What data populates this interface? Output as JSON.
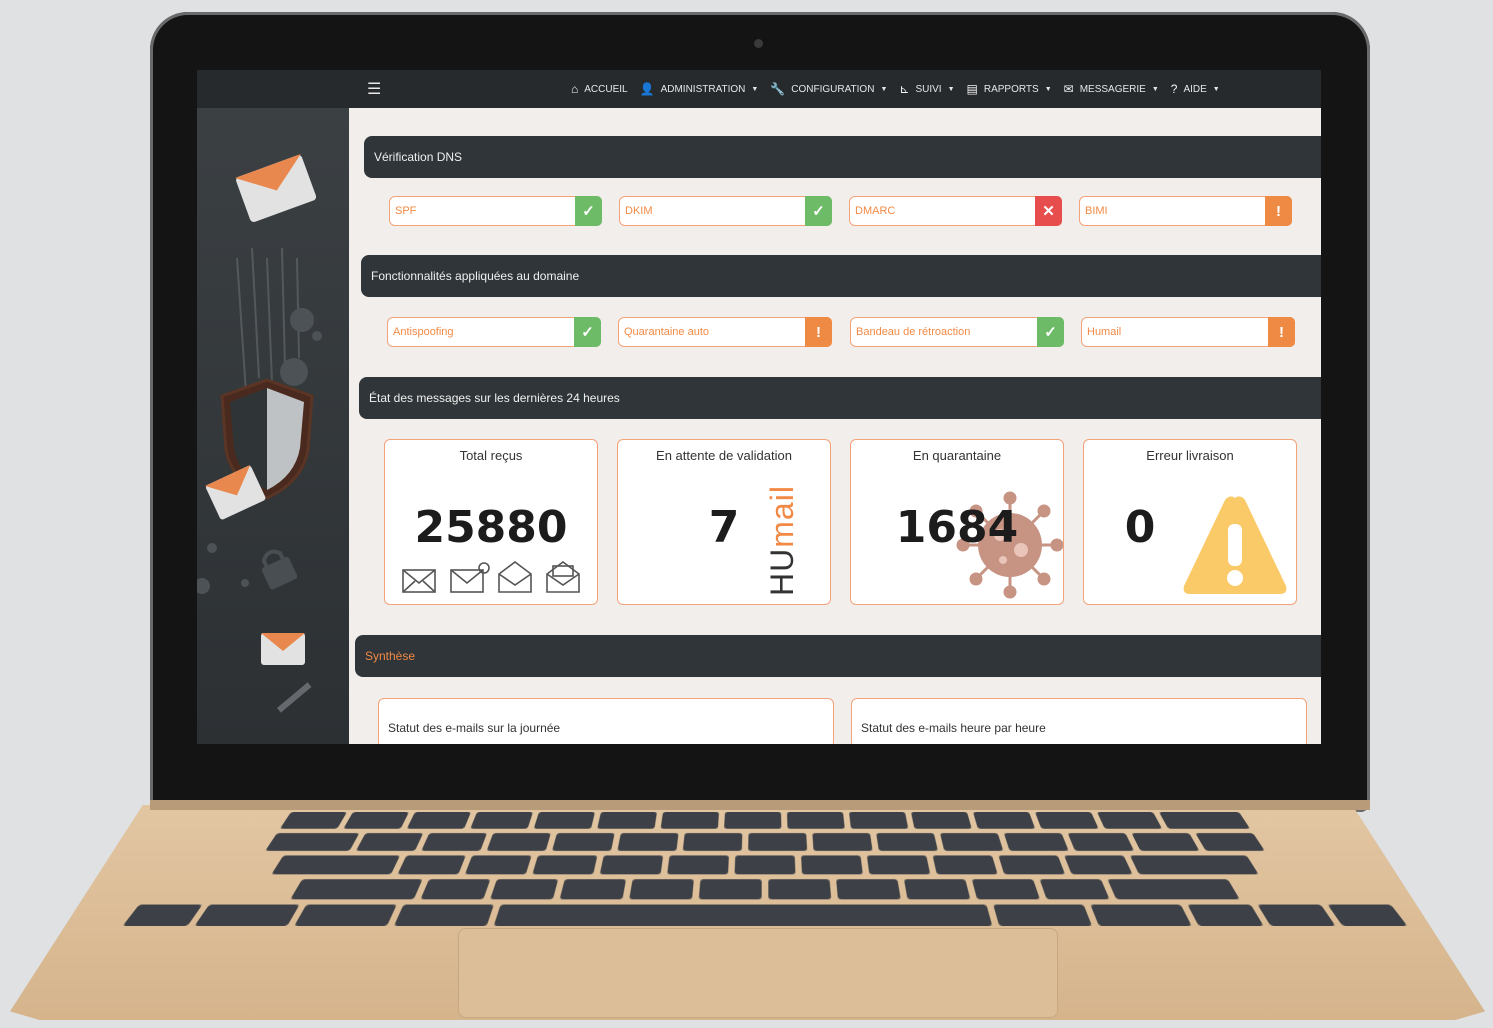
{
  "nav": {
    "items": [
      {
        "label": "ACCUEIL",
        "icon": "home-icon",
        "caret": false
      },
      {
        "label": "ADMINISTRATION",
        "icon": "user-gear-icon",
        "caret": true
      },
      {
        "label": "CONFIGURATION",
        "icon": "wrench-icon",
        "caret": true
      },
      {
        "label": "SUIVI",
        "icon": "chart-icon",
        "caret": true
      },
      {
        "label": "RAPPORTS",
        "icon": "document-icon",
        "caret": true
      },
      {
        "label": "MESSAGERIE",
        "icon": "envelope-icon",
        "caret": true
      },
      {
        "label": "AIDE",
        "icon": "question-icon",
        "caret": true
      }
    ]
  },
  "dns": {
    "title": "Vérification DNS",
    "checks": [
      {
        "label": "SPF",
        "status": "ok"
      },
      {
        "label": "DKIM",
        "status": "ok"
      },
      {
        "label": "DMARC",
        "status": "error"
      },
      {
        "label": "BIMI",
        "status": "warning"
      }
    ]
  },
  "features": {
    "title": "Fonctionnalités appliquées au domaine",
    "items": [
      {
        "label": "Antispoofing",
        "status": "ok"
      },
      {
        "label": "Quarantaine auto",
        "status": "warning"
      },
      {
        "label": "Bandeau de rétroaction",
        "status": "ok"
      },
      {
        "label": "Humail",
        "status": "warning"
      }
    ]
  },
  "messages": {
    "title": "État des messages sur les dernières 24 heures",
    "cards": [
      {
        "title": "Total reçus",
        "value": "25880"
      },
      {
        "title": "En attente de validation",
        "value": "7",
        "watermark": "HUmail"
      },
      {
        "title": "En quarantaine",
        "value": "1684"
      },
      {
        "title": "Erreur livraison",
        "value": "0"
      }
    ]
  },
  "synthese": {
    "title": "Synthèse",
    "panels": [
      {
        "title": "Statut des e-mails sur la journée"
      },
      {
        "title": "Statut des e-mails heure par heure"
      }
    ]
  },
  "colors": {
    "accent": "#f28a45",
    "ok": "#6dbb67",
    "error": "#e84d4d",
    "warning": "#ef8a44",
    "header": "#2f3538"
  }
}
